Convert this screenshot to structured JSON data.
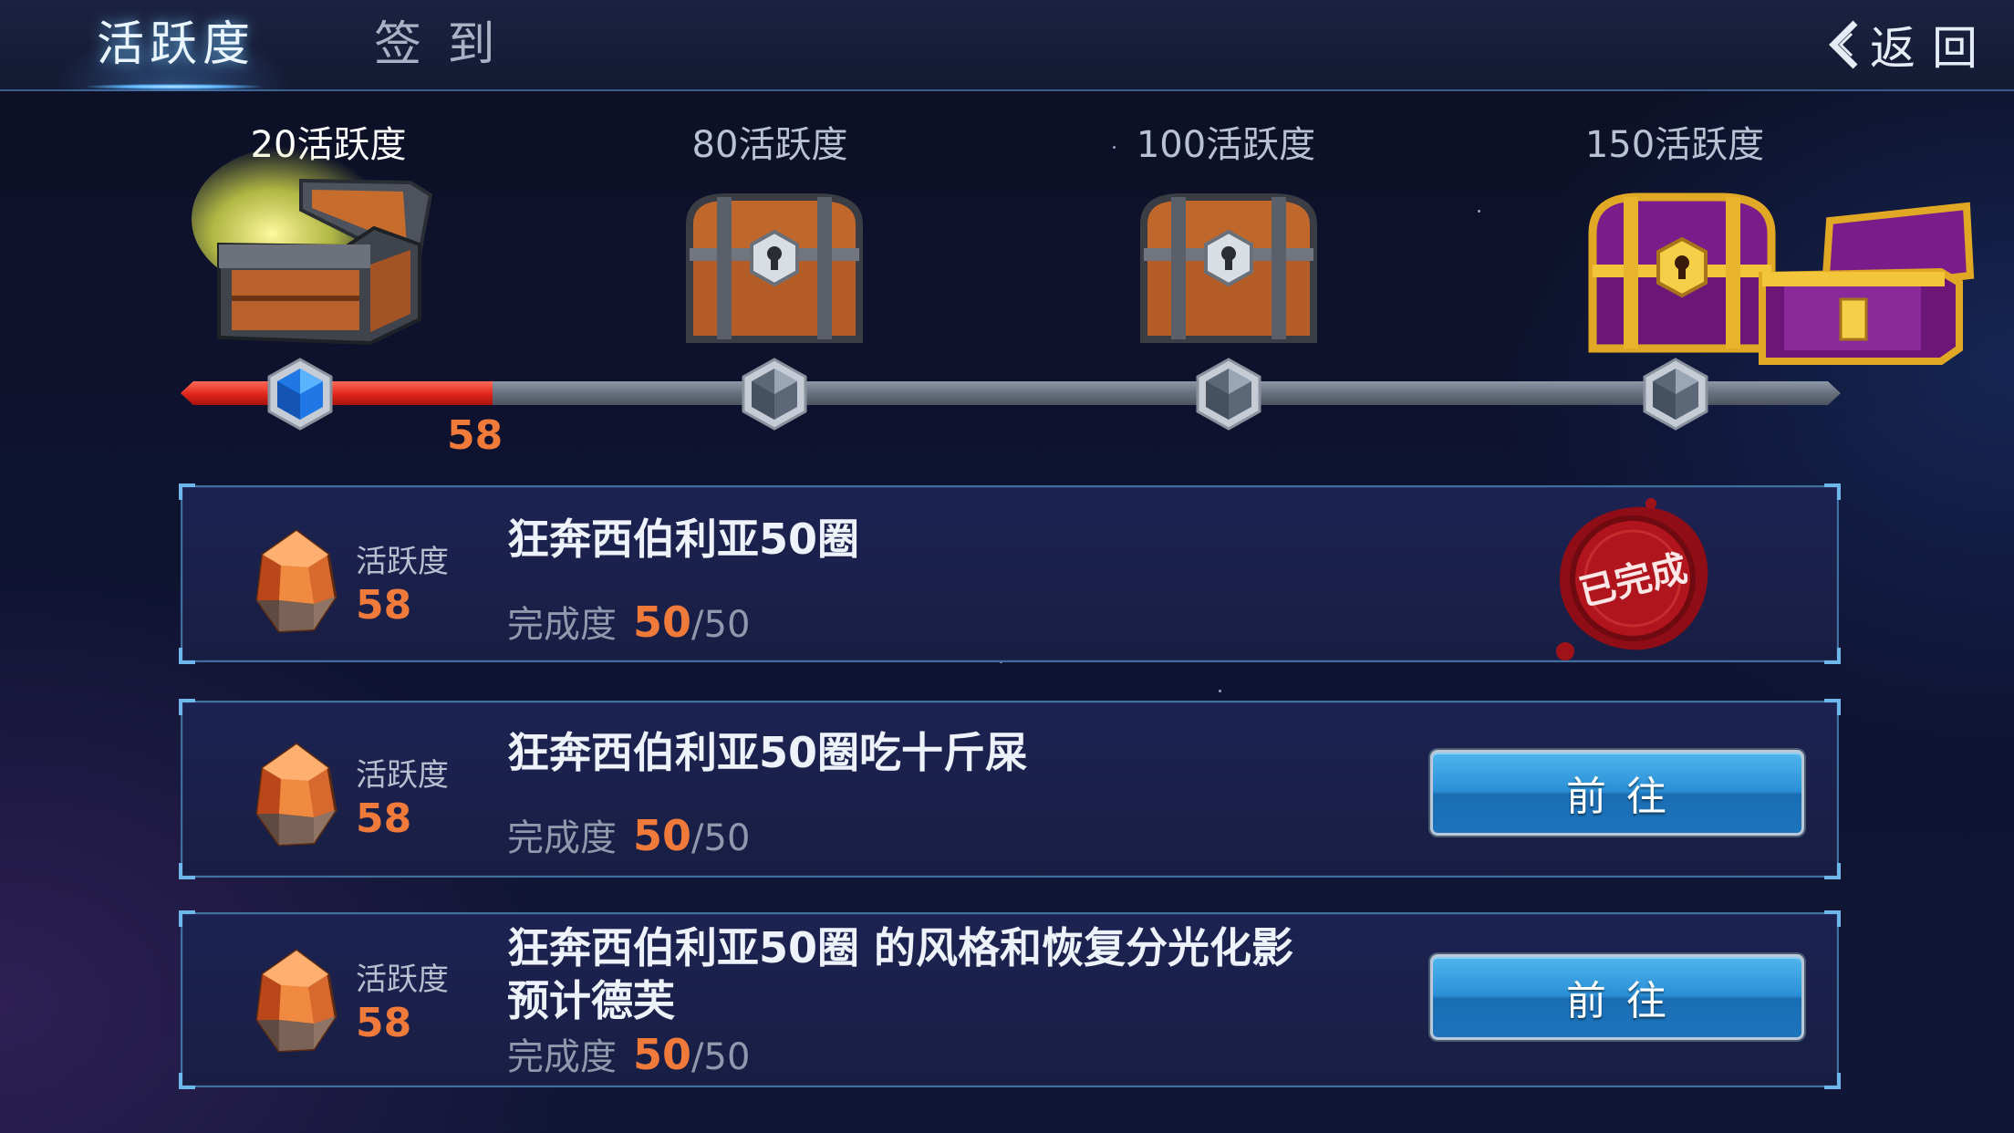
{
  "header": {
    "tabs": [
      {
        "label": "活跃度",
        "active": true
      },
      {
        "label": "签 到",
        "active": false
      }
    ],
    "back_label": "返回"
  },
  "track": {
    "current_value": "58",
    "max_value": 150,
    "fill_ratio": 0.188,
    "milestones": [
      {
        "label": "20活跃度",
        "state": "opened",
        "chest": "wooden-open"
      },
      {
        "label": "80活跃度",
        "state": "locked",
        "chest": "wooden"
      },
      {
        "label": "100活跃度",
        "state": "locked",
        "chest": "wooden"
      },
      {
        "label": "150活跃度",
        "state": "locked",
        "chest": "golden-pair"
      }
    ]
  },
  "tasks": [
    {
      "points_label": "活跃度",
      "points": "58",
      "title": "狂奔西伯利亚50圈",
      "progress_label": "完成度",
      "progress_done": "50",
      "progress_total": "/50",
      "status": "completed",
      "seal_text": "已完成"
    },
    {
      "points_label": "活跃度",
      "points": "58",
      "title": "狂奔西伯利亚50圈吃十斤屎",
      "progress_label": "完成度",
      "progress_done": "50",
      "progress_total": "/50",
      "status": "go",
      "button_label": "前往"
    },
    {
      "points_label": "活跃度",
      "points": "58",
      "title_line1": "狂奔西伯利亚50圈 的风格和恢复分光化影",
      "title_line2": "预计德芙",
      "progress_label": "完成度",
      "progress_done": "50",
      "progress_total": "/50",
      "status": "go",
      "button_label": "前往"
    }
  ],
  "colors": {
    "accent_orange": "#f07a3a",
    "progress_red": "#e0261b",
    "button_blue": "#2a8fd6",
    "seal_red": "#b0141c"
  }
}
